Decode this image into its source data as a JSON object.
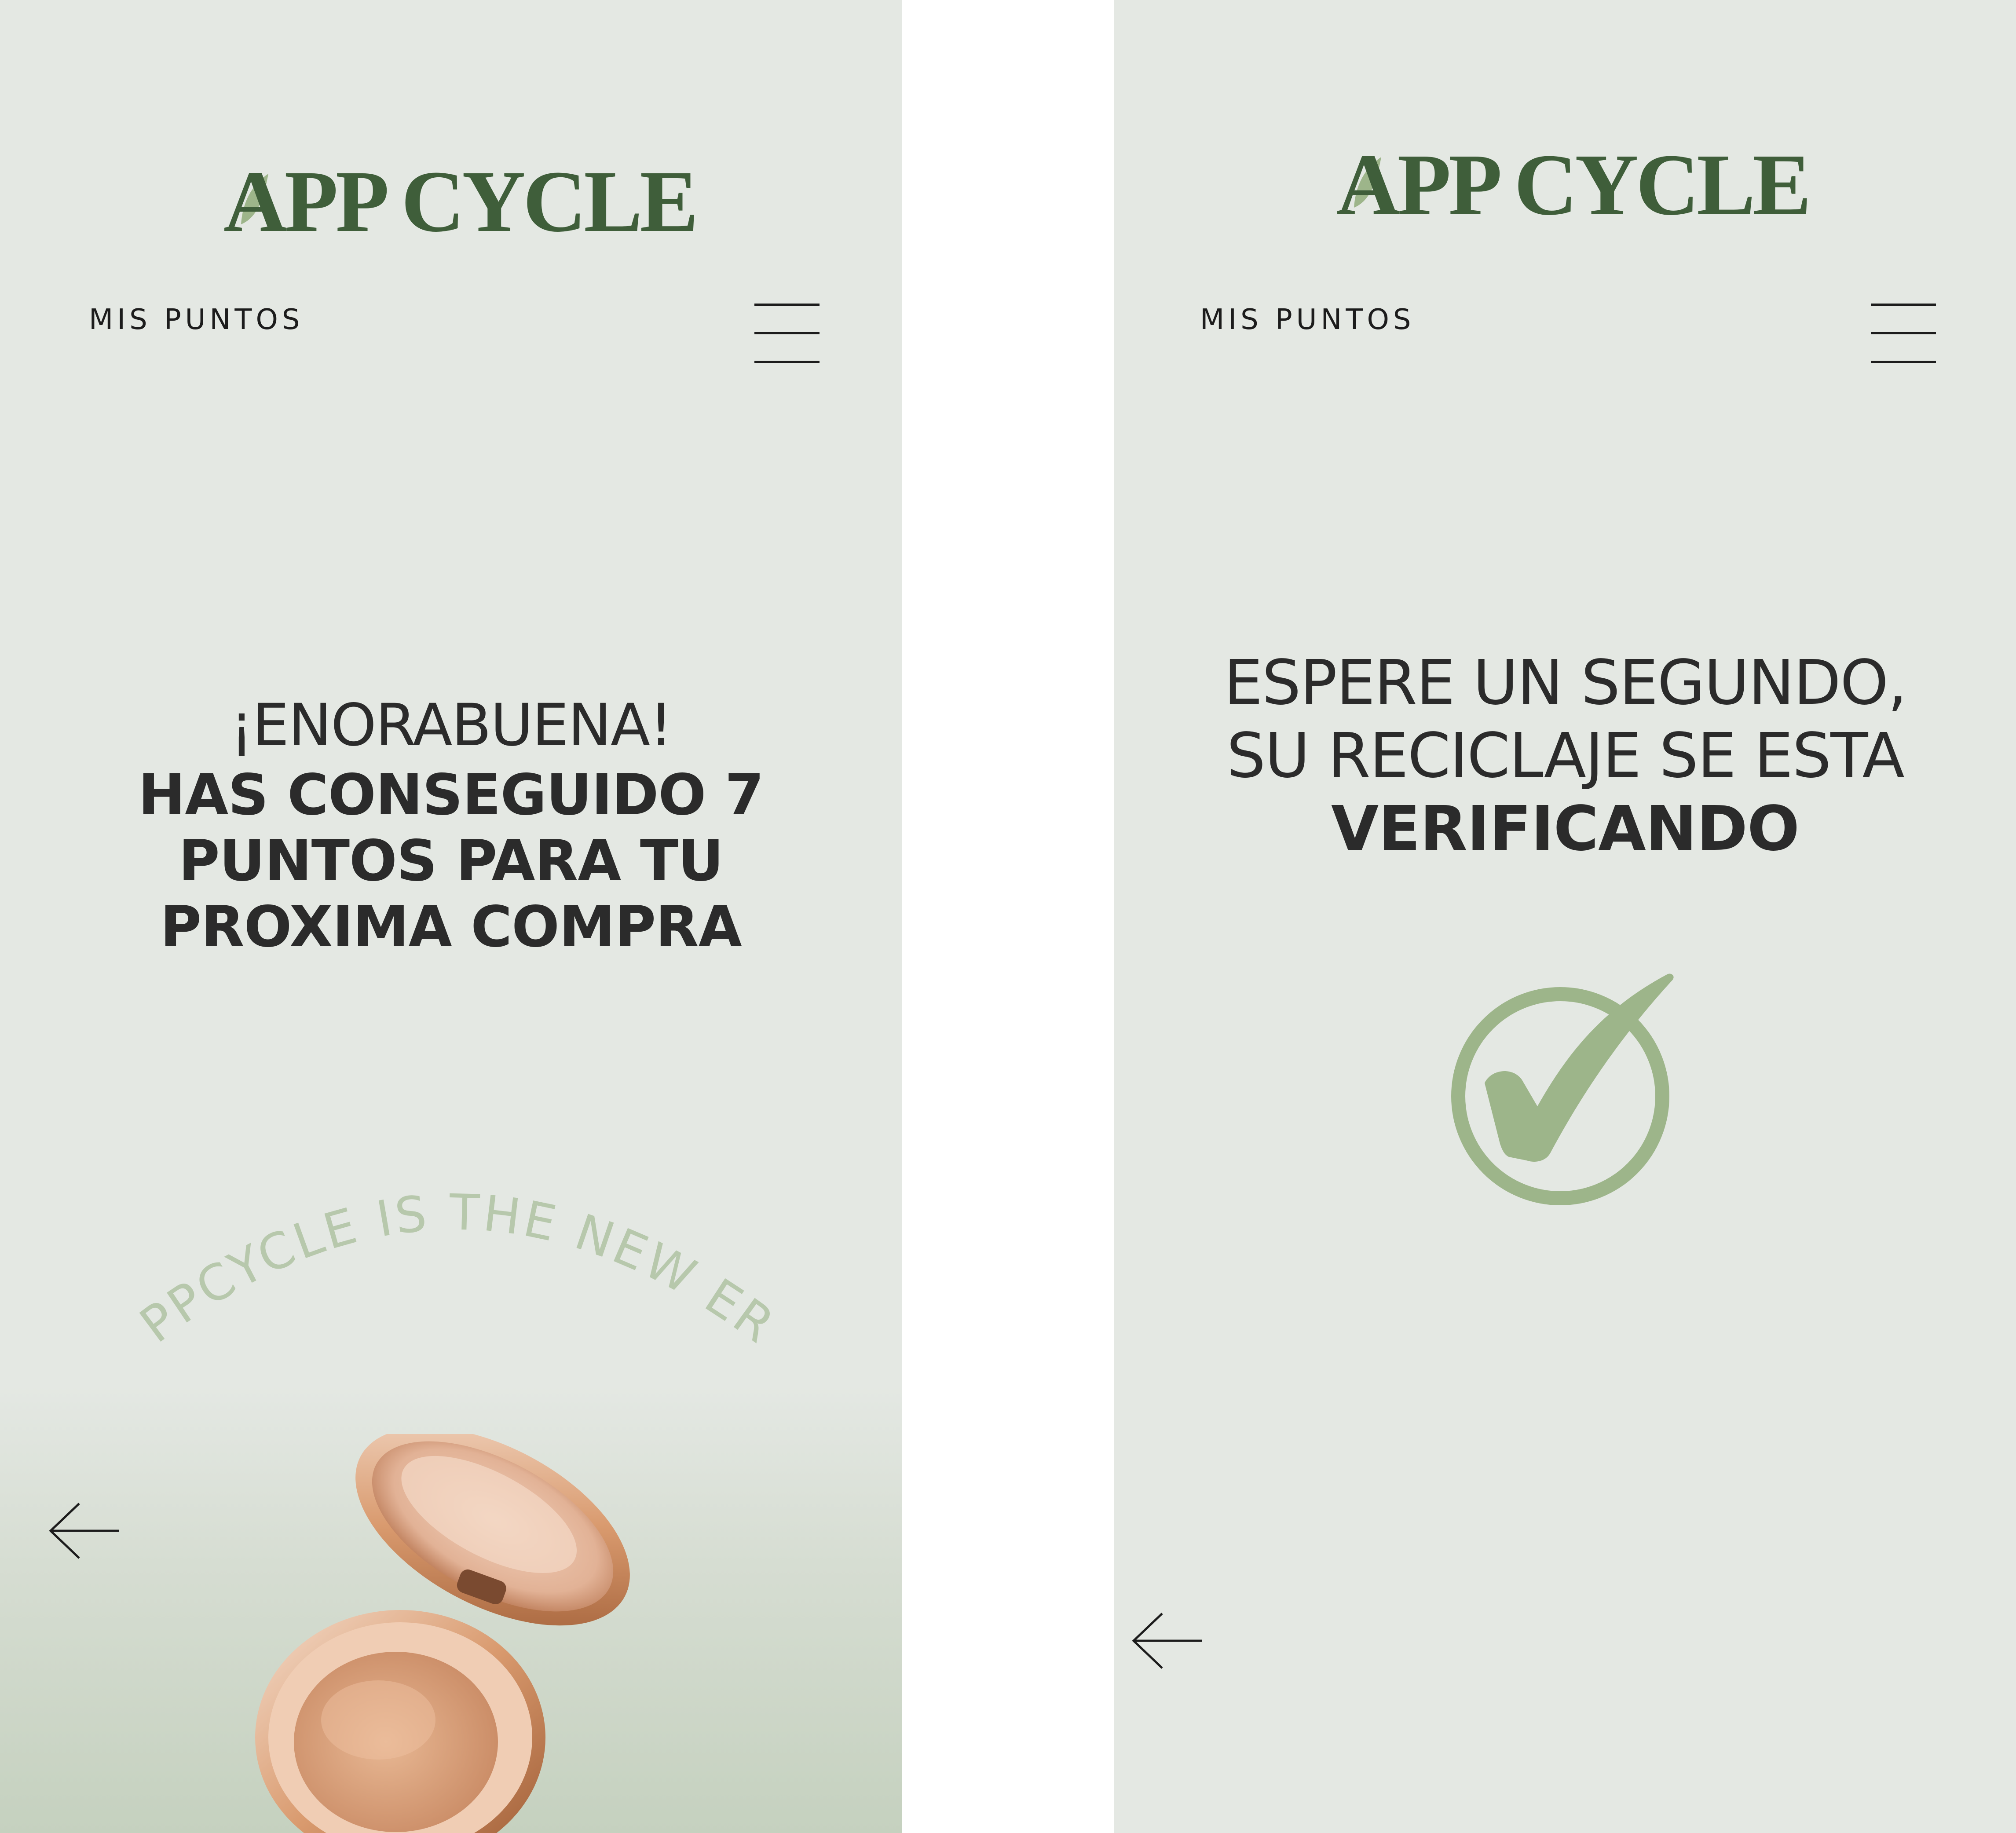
{
  "brand": {
    "logo_text": "APP CYCLE",
    "primary_color": "#3f5e3a",
    "leaf_color": "#9db58a",
    "accent_soft": "#b7c8ac",
    "background": "#e4e8e3"
  },
  "screens": [
    {
      "id": "congrats",
      "nav": {
        "points_label": "MIS PUNTOS",
        "menu_icon": "hamburger-menu-icon"
      },
      "headline": {
        "line1": "¡ENORABUENA!",
        "line2": "HAS CONSEGUIDO 7",
        "line3": "PUNTOS PARA TU",
        "line4": "PROXIMA COMPRA"
      },
      "points_awarded": 7,
      "tagline": "APPCYCLE IS THE NEW ERA",
      "product_image": "compact-powder-product",
      "back_icon": "arrow-left-icon"
    },
    {
      "id": "verifying",
      "nav": {
        "points_label": "MIS PUNTOS",
        "menu_icon": "hamburger-menu-icon"
      },
      "headline": {
        "line1": "ESPERE UN SEGUNDO,",
        "line2": "SU RECICLAJE SE ESTA",
        "line3": "VERIFICANDO"
      },
      "status_icon": "check-circle-icon",
      "back_icon": "arrow-left-icon"
    }
  ]
}
